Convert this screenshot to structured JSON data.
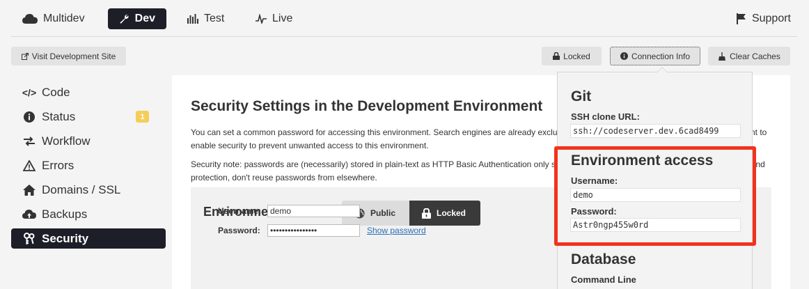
{
  "nav": {
    "multidev": "Multidev",
    "dev": "Dev",
    "test": "Test",
    "live": "Live",
    "support": "Support"
  },
  "toolbar": {
    "visit": "Visit Development Site",
    "locked": "Locked",
    "connection_info": "Connection Info",
    "clear_caches": "Clear Caches"
  },
  "sidebar": {
    "items": [
      {
        "label": "Code",
        "icon": "code-icon"
      },
      {
        "label": "Status",
        "icon": "info-icon",
        "badge": "1"
      },
      {
        "label": "Workflow",
        "icon": "workflow-icon"
      },
      {
        "label": "Errors",
        "icon": "warning-icon"
      },
      {
        "label": "Domains / SSL",
        "icon": "home-icon"
      },
      {
        "label": "Backups",
        "icon": "cloud-upload-icon"
      },
      {
        "label": "Security",
        "icon": "keys-icon",
        "active": true
      }
    ]
  },
  "main": {
    "title": "Security Settings in the Development Environment",
    "para1": "You can set a common password for accessing this environment. Search engines are already excluded from indexing this environment, but you may want to enable security to prevent unwanted access to this environment.",
    "para2": "Security note: passwords are (necessarily) stored in plain-text as HTTP Basic Authentication only supports plain-text passwords. For maximum security and protection, don't reuse passwords from elsewhere.",
    "panel": {
      "title": "Environment Access:",
      "public": "Public",
      "locked": "Locked",
      "username_label": "Username:",
      "username_value": "demo",
      "password_label": "Password:",
      "password_value": "••••••••••••••••",
      "show_password": "Show password"
    }
  },
  "popover": {
    "git_heading": "Git",
    "ssh_label": "SSH clone URL:",
    "ssh_value": "ssh://codeserver.dev.6cad8499",
    "env_heading": "Environment access",
    "username_label": "Username:",
    "username_value": "demo",
    "password_label": "Password:",
    "password_value": "Astr0ngp455w0rd",
    "db_heading": "Database",
    "cmd_label": "Command Line"
  },
  "colors": {
    "active_tab": "#1e1e28",
    "highlight": "#f2321c",
    "badge": "#f5cd5a"
  }
}
